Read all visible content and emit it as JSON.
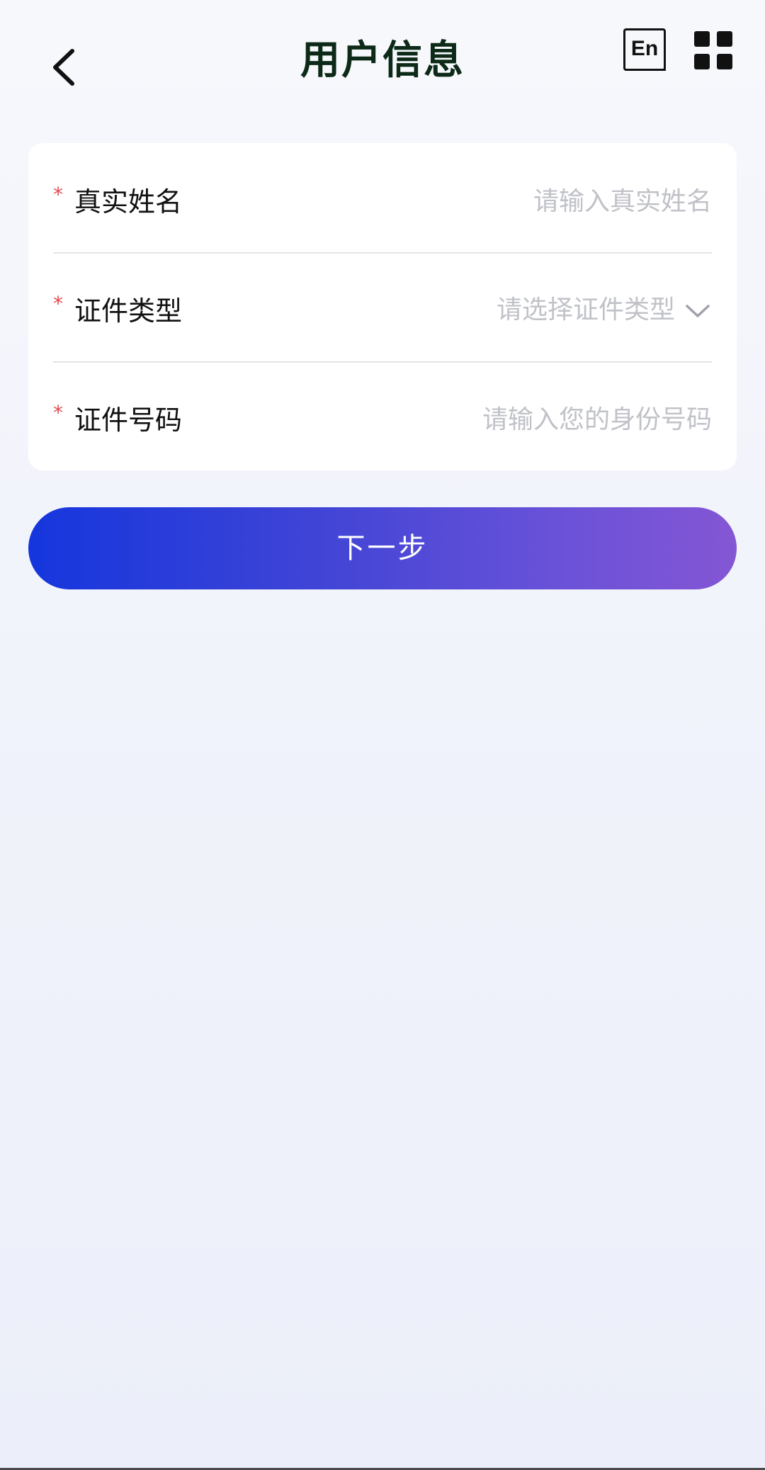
{
  "header": {
    "title": "用户信息",
    "back_icon": "chevron-left-icon",
    "language_label": "En",
    "menu_icon": "grid-icon"
  },
  "form": {
    "required_mark": "*",
    "fields": [
      {
        "label": "真实姓名",
        "type": "text",
        "value": "",
        "placeholder": "请输入真实姓名"
      },
      {
        "label": "证件类型",
        "type": "select",
        "value": "",
        "placeholder": "请选择证件类型",
        "icon": "chevron-down-icon"
      },
      {
        "label": "证件号码",
        "type": "text",
        "value": "",
        "placeholder": "请输入您的身份号码"
      }
    ]
  },
  "actions": {
    "next_label": "下一步"
  },
  "colors": {
    "title": "#0c2a17",
    "required": "#e5484d",
    "placeholder": "#c0c2c8",
    "button_gradient_start": "#1536dd",
    "button_gradient_end": "#8456d4"
  }
}
